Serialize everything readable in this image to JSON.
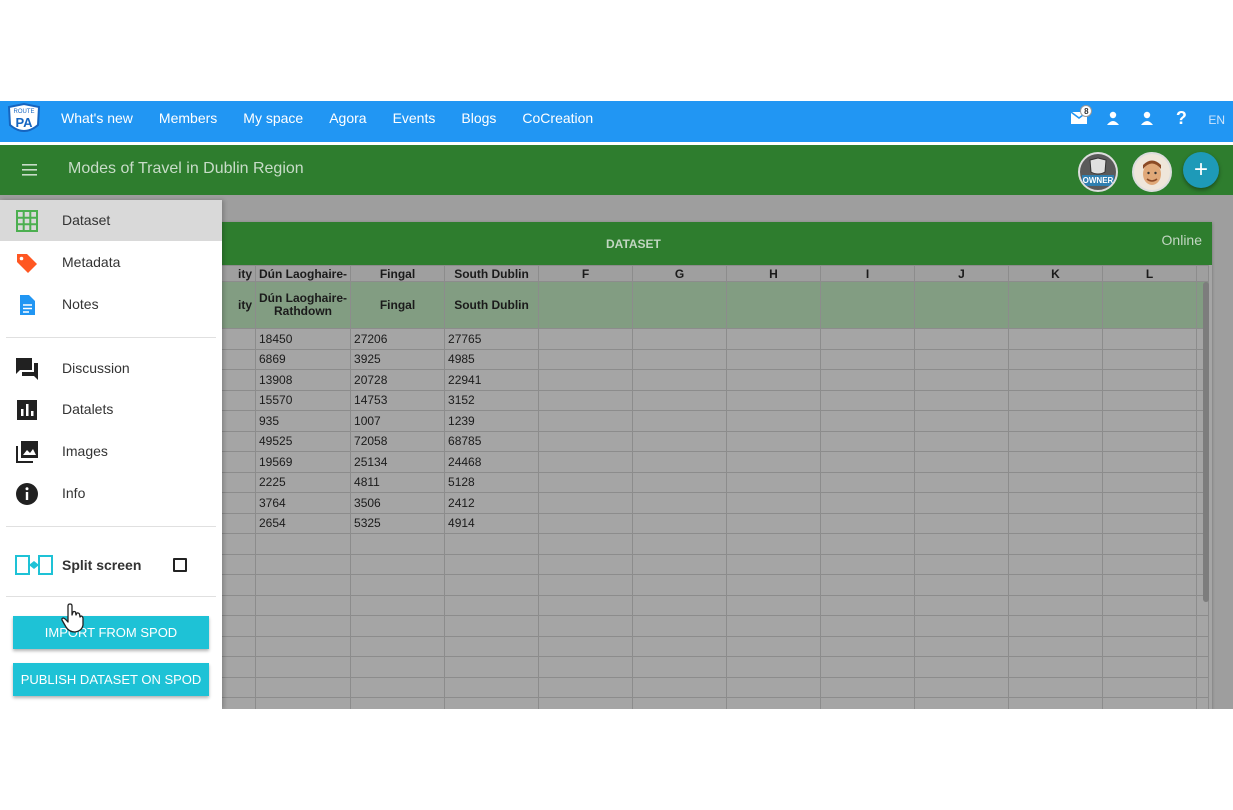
{
  "nav": {
    "logo_top": "ROUTE",
    "logo_main": "PA",
    "links": [
      "What's new",
      "Members",
      "My space",
      "Agora",
      "Events",
      "Blogs",
      "CoCreation"
    ],
    "mail_count": "8",
    "lang": "EN"
  },
  "header": {
    "title": "Modes of Travel in Dublin Region",
    "owner_label": "OWNER",
    "add_icon": "+"
  },
  "sheet": {
    "title": "DATASET",
    "status": "Online",
    "column_letters": [
      "ity",
      "Dún Laoghaire-",
      "Fingal",
      "South Dublin",
      "F",
      "G",
      "H",
      "I",
      "J",
      "K",
      "L"
    ],
    "header_row": [
      "ity",
      "Dún Laoghaire-Rathdown",
      "Fingal",
      "South Dublin",
      "",
      "",
      "",
      "",
      "",
      "",
      ""
    ],
    "rows": [
      [
        "",
        "18450",
        "27206",
        "27765"
      ],
      [
        "",
        "6869",
        "3925",
        "4985"
      ],
      [
        "",
        "13908",
        "20728",
        "22941"
      ],
      [
        "",
        "15570",
        "14753",
        "3152"
      ],
      [
        "",
        "935",
        "1007",
        "1239"
      ],
      [
        "",
        "49525",
        "72058",
        "68785"
      ],
      [
        "",
        "19569",
        "25134",
        "24468"
      ],
      [
        "",
        "2225",
        "4811",
        "5128"
      ],
      [
        "",
        "3764",
        "3506",
        "2412"
      ],
      [
        "",
        "2654",
        "5325",
        "4914"
      ]
    ],
    "empty_rows": 9
  },
  "drawer": {
    "items": [
      {
        "label": "Dataset",
        "icon": "grid-icon",
        "color": "#4caf50"
      },
      {
        "label": "Metadata",
        "icon": "tag-icon",
        "color": "#ff5722"
      },
      {
        "label": "Notes",
        "icon": "document-icon",
        "color": "#2196f3"
      },
      {
        "label": "Discussion",
        "icon": "forum-icon",
        "color": "#212121"
      },
      {
        "label": "Datalets",
        "icon": "bar-chart-icon",
        "color": "#212121"
      },
      {
        "label": "Images",
        "icon": "images-icon",
        "color": "#212121"
      },
      {
        "label": "Info",
        "icon": "info-icon",
        "color": "#212121"
      }
    ],
    "split_screen": "Split screen",
    "import_button": "IMPORT FROM SPOD",
    "publish_button": "PUBLISH DATASET ON SPOD"
  }
}
